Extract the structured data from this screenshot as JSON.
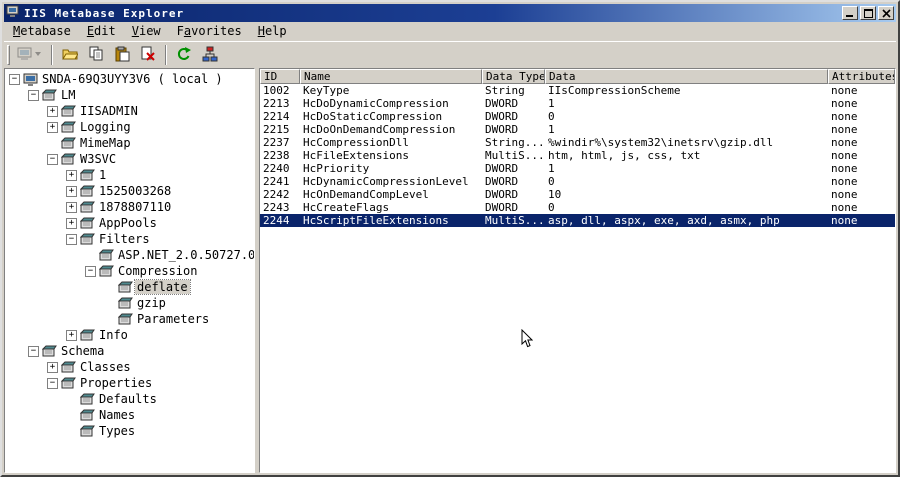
{
  "window": {
    "title": "IIS Metabase Explorer",
    "controls": [
      {
        "name": "minimize"
      },
      {
        "name": "maximize"
      },
      {
        "name": "close"
      }
    ]
  },
  "menu": {
    "items": [
      {
        "label": "Metabase",
        "accel": 0
      },
      {
        "label": "Edit",
        "accel": 0
      },
      {
        "label": "View",
        "accel": 0
      },
      {
        "label": "Favorites",
        "accel": 1
      },
      {
        "label": "Help",
        "accel": 0
      }
    ]
  },
  "toolbar": {
    "icons": [
      "connect-icon",
      "open-icon",
      "copy-icon",
      "paste-icon",
      "delete-icon",
      "refresh-icon",
      "network-icon"
    ]
  },
  "tree": {
    "items": [
      {
        "label": "SNDA-69Q3UYY3V6 ( local )",
        "level": 0,
        "toggle": "minus",
        "icon": "computer",
        "selected": false
      },
      {
        "label": "LM",
        "level": 1,
        "toggle": "minus",
        "icon": "node",
        "selected": false
      },
      {
        "label": "IISADMIN",
        "level": 2,
        "toggle": "plus",
        "icon": "node",
        "selected": false
      },
      {
        "label": "Logging",
        "level": 2,
        "toggle": "plus",
        "icon": "node",
        "selected": false
      },
      {
        "label": "MimeMap",
        "level": 2,
        "toggle": null,
        "icon": "node",
        "selected": false
      },
      {
        "label": "W3SVC",
        "level": 2,
        "toggle": "minus",
        "icon": "node",
        "selected": false
      },
      {
        "label": "1",
        "level": 3,
        "toggle": "plus",
        "icon": "node",
        "selected": false
      },
      {
        "label": "1525003268",
        "level": 3,
        "toggle": "plus",
        "icon": "node",
        "selected": false
      },
      {
        "label": "1878807110",
        "level": 3,
        "toggle": "plus",
        "icon": "node",
        "selected": false
      },
      {
        "label": "AppPools",
        "level": 3,
        "toggle": "plus",
        "icon": "node",
        "selected": false
      },
      {
        "label": "Filters",
        "level": 3,
        "toggle": "minus",
        "icon": "node",
        "selected": false
      },
      {
        "label": "ASP.NET_2.0.50727.0",
        "level": 4,
        "toggle": null,
        "icon": "node",
        "selected": false
      },
      {
        "label": "Compression",
        "level": 4,
        "toggle": "minus",
        "icon": "node",
        "selected": false
      },
      {
        "label": "deflate",
        "level": 5,
        "toggle": null,
        "icon": "node",
        "selected": true
      },
      {
        "label": "gzip",
        "level": 5,
        "toggle": null,
        "icon": "node",
        "selected": false
      },
      {
        "label": "Parameters",
        "level": 5,
        "toggle": null,
        "icon": "node",
        "selected": false
      },
      {
        "label": "Info",
        "level": 3,
        "toggle": "plus",
        "icon": "node",
        "selected": false
      },
      {
        "label": "Schema",
        "level": 1,
        "toggle": "minus",
        "icon": "node",
        "selected": false
      },
      {
        "label": "Classes",
        "level": 2,
        "toggle": "plus",
        "icon": "node",
        "selected": false
      },
      {
        "label": "Properties",
        "level": 2,
        "toggle": "minus",
        "icon": "node",
        "selected": false
      },
      {
        "label": "Defaults",
        "level": 3,
        "toggle": null,
        "icon": "node",
        "selected": false
      },
      {
        "label": "Names",
        "level": 3,
        "toggle": null,
        "icon": "node",
        "selected": false
      },
      {
        "label": "Types",
        "level": 3,
        "toggle": null,
        "icon": "node",
        "selected": false
      }
    ]
  },
  "list": {
    "columns": [
      "ID",
      "Name",
      "Data Type",
      "Data",
      "Attributes"
    ],
    "rows": [
      {
        "cells": [
          "1002",
          "KeyType",
          "String",
          "IIsCompressionScheme",
          "none"
        ],
        "selected": false
      },
      {
        "cells": [
          "2213",
          "HcDoDynamicCompression",
          "DWORD",
          "1",
          "none"
        ],
        "selected": false
      },
      {
        "cells": [
          "2214",
          "HcDoStaticCompression",
          "DWORD",
          "0",
          "none"
        ],
        "selected": false
      },
      {
        "cells": [
          "2215",
          "HcDoOnDemandCompression",
          "DWORD",
          "1",
          "none"
        ],
        "selected": false
      },
      {
        "cells": [
          "2237",
          "HcCompressionDll",
          "String...",
          "%windir%\\system32\\inetsrv\\gzip.dll",
          "none"
        ],
        "selected": false
      },
      {
        "cells": [
          "2238",
          "HcFileExtensions",
          "MultiS...",
          "htm, html, js, css, txt",
          "none"
        ],
        "selected": false
      },
      {
        "cells": [
          "2240",
          "HcPriority",
          "DWORD",
          "1",
          "none"
        ],
        "selected": false
      },
      {
        "cells": [
          "2241",
          "HcDynamicCompressionLevel",
          "DWORD",
          "0",
          "none"
        ],
        "selected": false
      },
      {
        "cells": [
          "2242",
          "HcOnDemandCompLevel",
          "DWORD",
          "10",
          "none"
        ],
        "selected": false
      },
      {
        "cells": [
          "2243",
          "HcCreateFlags",
          "DWORD",
          "0",
          "none"
        ],
        "selected": false
      },
      {
        "cells": [
          "2244",
          "HcScriptFileExtensions",
          "MultiS...",
          "asp, dll, aspx, exe, axd, asmx, php",
          "none"
        ],
        "selected": true
      }
    ]
  },
  "colors": {
    "titlebar_start": "#0a246a",
    "titlebar_end": "#a6caf0",
    "chrome": "#d4d0c8",
    "selection": "#0a246a"
  }
}
